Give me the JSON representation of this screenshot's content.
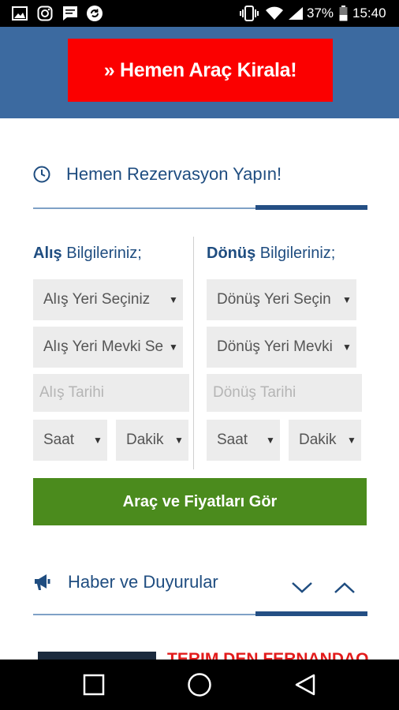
{
  "status_bar": {
    "battery": "37%",
    "time": "15:40",
    "icons": [
      "gallery-icon",
      "instagram-icon",
      "message-icon",
      "sync-icon",
      "vibrate-icon",
      "wifi-icon",
      "signal-icon",
      "battery-icon"
    ]
  },
  "header": {
    "cta_label": "» Hemen Araç Kirala!"
  },
  "reservation": {
    "title": "Hemen Rezervasyon Yapın!",
    "pickup": {
      "title_bold": "Alış",
      "title_rest": " Bilgileriniz;",
      "location_select": "Alış Yeri Seçiniz",
      "place_select": "Alış Yeri Mevki Se",
      "date_placeholder": "Alış Tarihi",
      "hour_select": "Saat",
      "minute_select": "Dakik"
    },
    "dropoff": {
      "title_bold": "Dönüş",
      "title_rest": " Bilgileriniz;",
      "location_select": "Dönüş Yeri Seçin",
      "place_select": "Dönüş Yeri Mevki",
      "date_placeholder": "Dönüş Tarihi",
      "hour_select": "Saat",
      "minute_select": "Dakik"
    },
    "submit_label": "Araç ve Fiyatları Gör"
  },
  "news": {
    "title": "Haber ve Duyurular",
    "headline_partial": "TERİM DEN FERNANDAO"
  },
  "colors": {
    "header_blue": "#3c6aa0",
    "cta_red": "#fb0000",
    "submit_green": "#4b8b1d",
    "heading_blue": "#1f4d80"
  }
}
